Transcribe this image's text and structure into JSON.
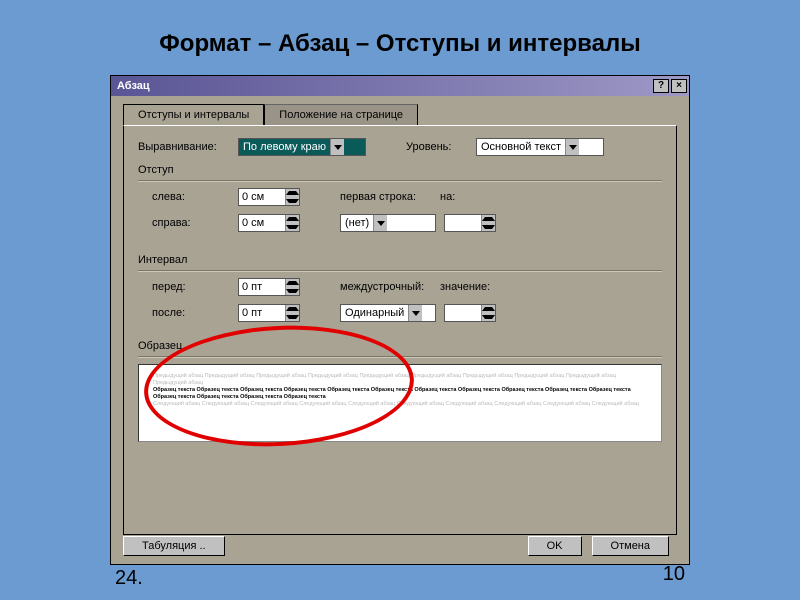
{
  "slide": {
    "title": "Формат – Абзац – Отступы и интервалы",
    "page_left": "24.",
    "page_right": "10"
  },
  "dialog": {
    "title": "Абзац",
    "help": "?",
    "close": "×",
    "tabs": {
      "t1": "Отступы и интервалы",
      "t2": "Положение на странице"
    },
    "alignment": {
      "label": "Выравнивание:",
      "value": "По левому краю"
    },
    "level": {
      "label": "Уровень:",
      "value": "Основной текст"
    },
    "indent": {
      "group": "Отступ",
      "left": {
        "label": "слева:",
        "value": "0 см"
      },
      "right": {
        "label": "справа:",
        "value": "0 см"
      },
      "first_line": {
        "label": "первая строка:",
        "value": "(нет)"
      },
      "by": {
        "label": "на:",
        "value": ""
      }
    },
    "spacing": {
      "group": "Интервал",
      "before": {
        "label": "перед:",
        "value": "0 пт"
      },
      "after": {
        "label": "после:",
        "value": "0 пт"
      },
      "line": {
        "label": "междустрочный:",
        "value": "Одинарный"
      },
      "at": {
        "label": "значение:",
        "value": ""
      }
    },
    "preview": {
      "label": "Образец",
      "grey1": "Предыдущий абзац Предыдущий абзац Предыдущий абзац Предыдущий абзац Предыдущий абзац Предыдущий абзац Предыдущий абзац Предыдущий абзац Предыдущий абзац Предыдущий абзац",
      "dark": "Образец текста Образец текста Образец текста Образец текста Образец текста Образец текста Образец текста Образец текста Образец текста Образец текста Образец текста Образец текста Образец текста Образец текста Образец текста",
      "grey2": "Следующий абзац Следующий абзац Следующий абзац Следующий абзац Следующий абзац Следующий абзац Следующий абзац Следующий абзац Следующий абзац Следующий абзац"
    },
    "buttons": {
      "tabs": "Табуляция ..",
      "ok": "OK",
      "cancel": "Отмена"
    }
  }
}
